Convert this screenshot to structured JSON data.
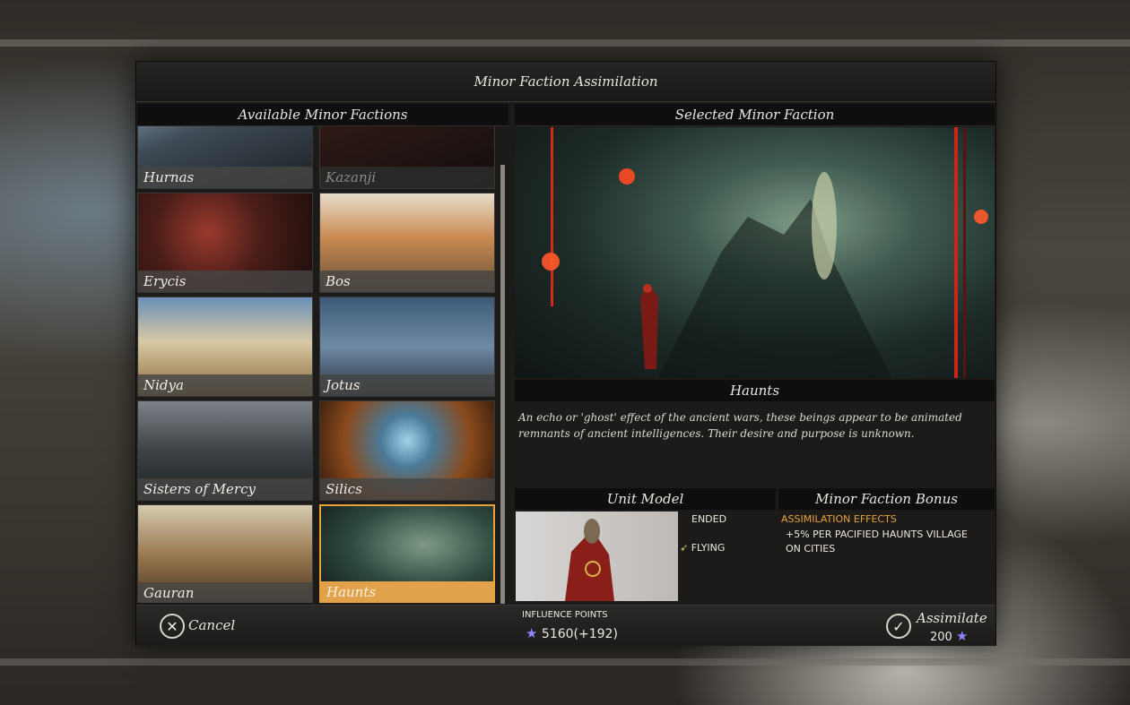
{
  "dialog": {
    "title": "Minor Faction Assimilation",
    "left_header": "Available Minor Factions",
    "right_header": "Selected Minor Faction"
  },
  "factions": [
    {
      "name": "Hurnas"
    },
    {
      "name": "Kazanji"
    },
    {
      "name": "Erycis"
    },
    {
      "name": "Bos"
    },
    {
      "name": "Nidya"
    },
    {
      "name": "Jotus"
    },
    {
      "name": "Sisters of Mercy"
    },
    {
      "name": "Silics"
    },
    {
      "name": "Gauran"
    },
    {
      "name": "Haunts"
    }
  ],
  "selected": {
    "name": "Haunts",
    "description": "An echo or 'ghost' effect of the ancient wars, these beings appear to be animated remnants of ancient intelligences. Their desire and purpose is unknown.",
    "unit_model_header": "Unit Model",
    "bonus_header": "Minor Faction Bonus",
    "unit_props": [
      "ENDED",
      "FLYING"
    ],
    "bonus_title": "ASSIMILATION EFFECTS",
    "bonus_text": "+5% PER PACIFIED HAUNTS VILLAGE ON CITIES"
  },
  "footer": {
    "cancel_label": "Cancel",
    "influence_label": "INFLUENCE POINTS",
    "influence_value": "5160(+192)",
    "assimilate_label": "Assimilate",
    "assimilate_cost": "200"
  },
  "colors": {
    "accent": "#e7a23c",
    "influence_star": "#8f86ff"
  }
}
